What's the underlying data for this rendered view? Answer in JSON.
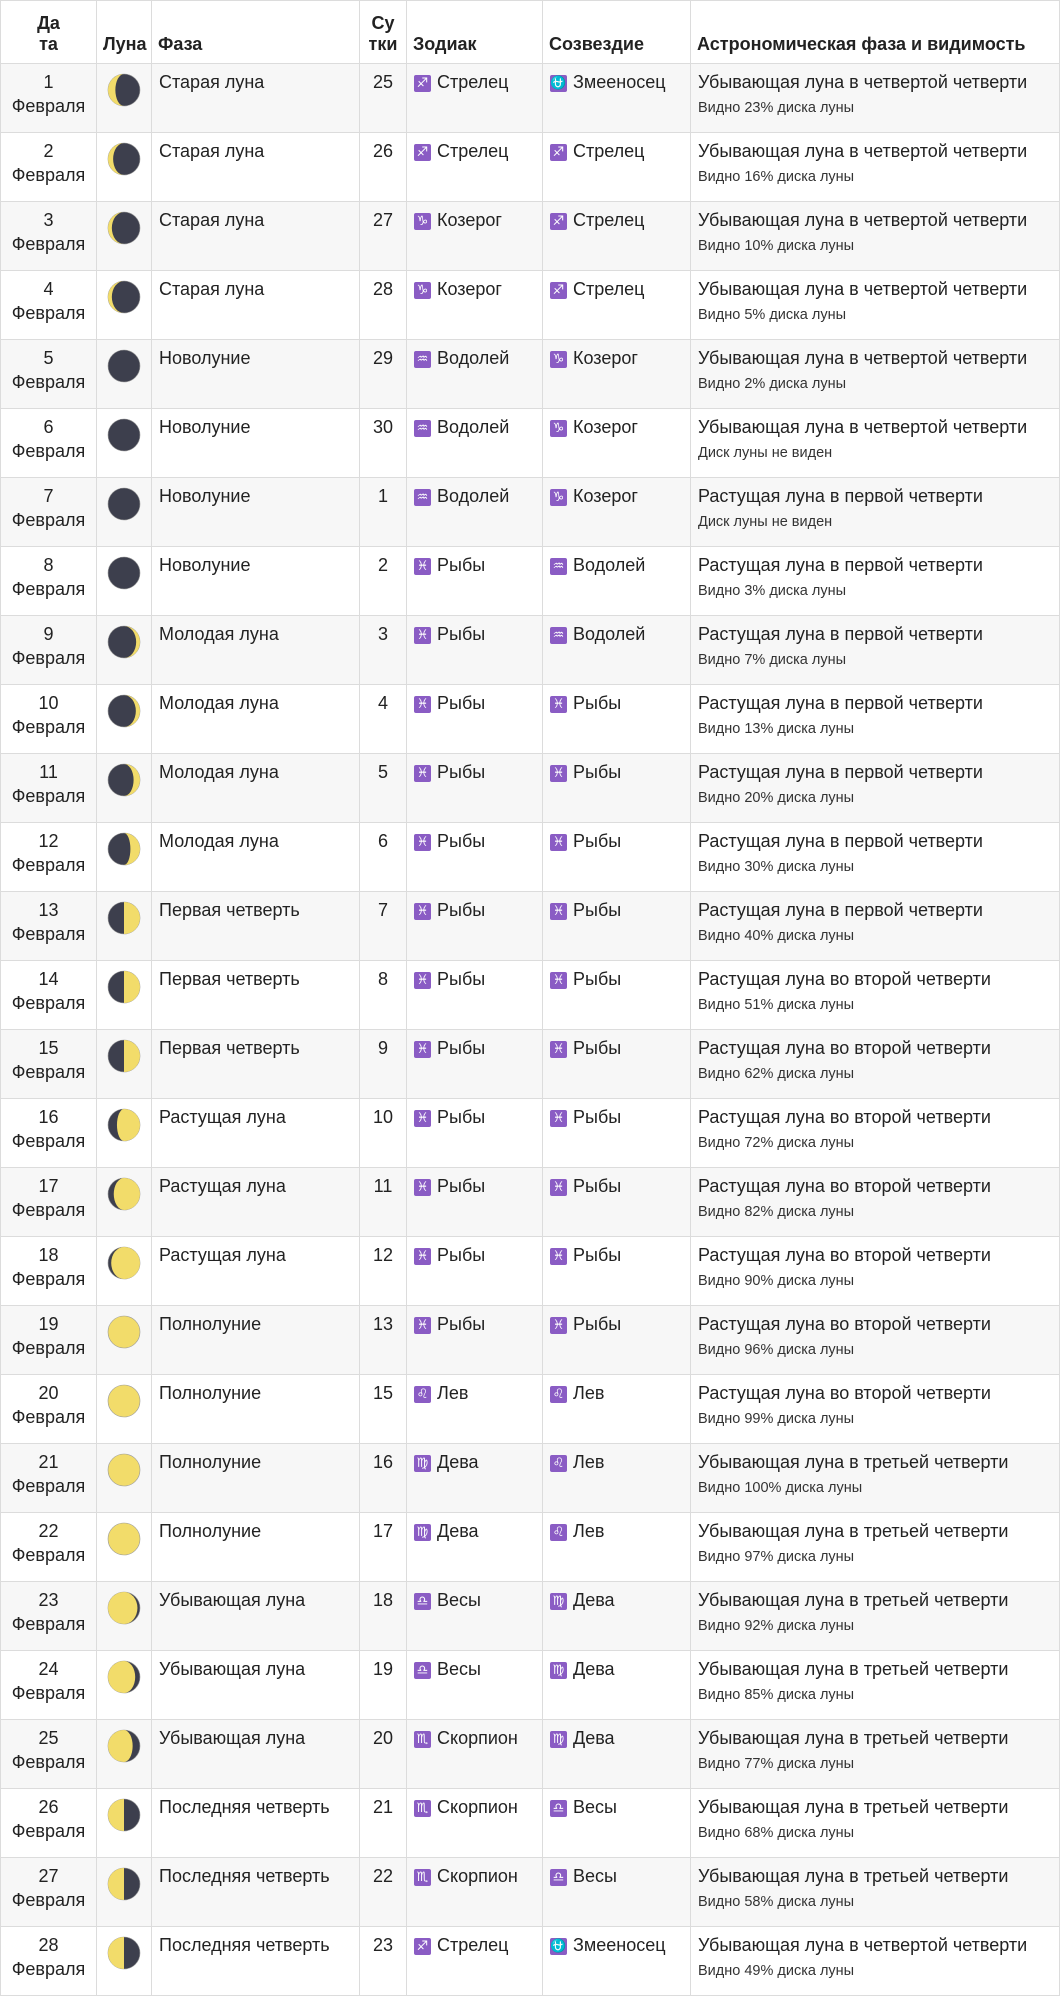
{
  "headers": {
    "date_line1": "Да",
    "date_line2": "та",
    "moon": "Луна",
    "phase": "Фаза",
    "day_line1": "Су",
    "day_line2": "тки",
    "zodiac": "Зодиак",
    "constellation": "Созвездие",
    "astro": "Астрономическая фаза и видимость"
  },
  "colors": {
    "sign_bg": "#8a5cc4",
    "moon_light": "#f2dc6a",
    "moon_dark": "#3d3f4d"
  },
  "rows": [
    {
      "day": "1",
      "month": "Февраля",
      "moon_icon": "waning-crescent",
      "moon_lit": 0.23,
      "phase": "Старая луна",
      "age": "25",
      "zodiac_glyph": "♐",
      "zodiac": "Стрелец",
      "const_glyph": "⛎",
      "constellation": "Змееносец",
      "astro": "Убывающая луна в четвертой четверти",
      "visibility": "Видно 23% диска луны"
    },
    {
      "day": "2",
      "month": "Февраля",
      "moon_icon": "waning-crescent",
      "moon_lit": 0.16,
      "phase": "Старая луна",
      "age": "26",
      "zodiac_glyph": "♐",
      "zodiac": "Стрелец",
      "const_glyph": "♐",
      "constellation": "Стрелец",
      "astro": "Убывающая луна в четвертой четверти",
      "visibility": "Видно 16% диска луны"
    },
    {
      "day": "3",
      "month": "Февраля",
      "moon_icon": "waning-crescent",
      "moon_lit": 0.1,
      "phase": "Старая луна",
      "age": "27",
      "zodiac_glyph": "♑",
      "zodiac": "Козерог",
      "const_glyph": "♐",
      "constellation": "Стрелец",
      "astro": "Убывающая луна в четвертой четверти",
      "visibility": "Видно 10% диска луны"
    },
    {
      "day": "4",
      "month": "Февраля",
      "moon_icon": "waning-crescent",
      "moon_lit": 0.05,
      "phase": "Старая луна",
      "age": "28",
      "zodiac_glyph": "♑",
      "zodiac": "Козерог",
      "const_glyph": "♐",
      "constellation": "Стрелец",
      "astro": "Убывающая луна в четвертой четверти",
      "visibility": "Видно 5% диска луны"
    },
    {
      "day": "5",
      "month": "Февраля",
      "moon_icon": "new-moon",
      "moon_lit": 0.02,
      "phase": "Новолуние",
      "age": "29",
      "zodiac_glyph": "♒",
      "zodiac": "Водолей",
      "const_glyph": "♑",
      "constellation": "Козерог",
      "astro": "Убывающая луна в четвертой четверти",
      "visibility": "Видно 2% диска луны"
    },
    {
      "day": "6",
      "month": "Февраля",
      "moon_icon": "new-moon",
      "moon_lit": 0,
      "phase": "Новолуние",
      "age": "30",
      "zodiac_glyph": "♒",
      "zodiac": "Водолей",
      "const_glyph": "♑",
      "constellation": "Козерог",
      "astro": "Убывающая луна в четвертой четверти",
      "visibility": "Диск луны не виден"
    },
    {
      "day": "7",
      "month": "Февраля",
      "moon_icon": "new-moon",
      "moon_lit": 0,
      "phase": "Новолуние",
      "age": "1",
      "zodiac_glyph": "♒",
      "zodiac": "Водолей",
      "const_glyph": "♑",
      "constellation": "Козерог",
      "astro": "Растущая луна в первой четверти",
      "visibility": "Диск луны не виден"
    },
    {
      "day": "8",
      "month": "Февраля",
      "moon_icon": "new-moon",
      "moon_lit": 0.03,
      "phase": "Новолуние",
      "age": "2",
      "zodiac_glyph": "♓",
      "zodiac": "Рыбы",
      "const_glyph": "♒",
      "constellation": "Водолей",
      "astro": "Растущая луна в первой четверти",
      "visibility": "Видно 3% диска луны"
    },
    {
      "day": "9",
      "month": "Февраля",
      "moon_icon": "waxing-crescent",
      "moon_lit": 0.07,
      "phase": "Молодая луна",
      "age": "3",
      "zodiac_glyph": "♓",
      "zodiac": "Рыбы",
      "const_glyph": "♒",
      "constellation": "Водолей",
      "astro": "Растущая луна в первой четверти",
      "visibility": "Видно 7% диска луны"
    },
    {
      "day": "10",
      "month": "Февраля",
      "moon_icon": "waxing-crescent",
      "moon_lit": 0.13,
      "phase": "Молодая луна",
      "age": "4",
      "zodiac_glyph": "♓",
      "zodiac": "Рыбы",
      "const_glyph": "♓",
      "constellation": "Рыбы",
      "astro": "Растущая луна в первой четверти",
      "visibility": "Видно 13% диска луны"
    },
    {
      "day": "11",
      "month": "Февраля",
      "moon_icon": "waxing-crescent",
      "moon_lit": 0.2,
      "phase": "Молодая луна",
      "age": "5",
      "zodiac_glyph": "♓",
      "zodiac": "Рыбы",
      "const_glyph": "♓",
      "constellation": "Рыбы",
      "astro": "Растущая луна в первой четверти",
      "visibility": "Видно 20% диска луны"
    },
    {
      "day": "12",
      "month": "Февраля",
      "moon_icon": "waxing-crescent",
      "moon_lit": 0.3,
      "phase": "Молодая луна",
      "age": "6",
      "zodiac_glyph": "♓",
      "zodiac": "Рыбы",
      "const_glyph": "♓",
      "constellation": "Рыбы",
      "astro": "Растущая луна в первой четверти",
      "visibility": "Видно 30% диска луны"
    },
    {
      "day": "13",
      "month": "Февраля",
      "moon_icon": "first-quarter",
      "moon_lit": 0.4,
      "phase": "Первая четверть",
      "age": "7",
      "zodiac_glyph": "♓",
      "zodiac": "Рыбы",
      "const_glyph": "♓",
      "constellation": "Рыбы",
      "astro": "Растущая луна в первой четверти",
      "visibility": "Видно 40% диска луны"
    },
    {
      "day": "14",
      "month": "Февраля",
      "moon_icon": "first-quarter",
      "moon_lit": 0.51,
      "phase": "Первая четверть",
      "age": "8",
      "zodiac_glyph": "♓",
      "zodiac": "Рыбы",
      "const_glyph": "♓",
      "constellation": "Рыбы",
      "astro": "Растущая луна во второй четверти",
      "visibility": "Видно 51% диска луны"
    },
    {
      "day": "15",
      "month": "Февраля",
      "moon_icon": "first-quarter",
      "moon_lit": 0.62,
      "phase": "Первая четверть",
      "age": "9",
      "zodiac_glyph": "♓",
      "zodiac": "Рыбы",
      "const_glyph": "♓",
      "constellation": "Рыбы",
      "astro": "Растущая луна во второй четверти",
      "visibility": "Видно 62% диска луны"
    },
    {
      "day": "16",
      "month": "Февраля",
      "moon_icon": "waxing-gibbous",
      "moon_lit": 0.72,
      "phase": "Растущая луна",
      "age": "10",
      "zodiac_glyph": "♓",
      "zodiac": "Рыбы",
      "const_glyph": "♓",
      "constellation": "Рыбы",
      "astro": "Растущая луна во второй четверти",
      "visibility": "Видно 72% диска луны"
    },
    {
      "day": "17",
      "month": "Февраля",
      "moon_icon": "waxing-gibbous",
      "moon_lit": 0.82,
      "phase": "Растущая луна",
      "age": "11",
      "zodiac_glyph": "♓",
      "zodiac": "Рыбы",
      "const_glyph": "♓",
      "constellation": "Рыбы",
      "astro": "Растущая луна во второй четверти",
      "visibility": "Видно 82% диска луны"
    },
    {
      "day": "18",
      "month": "Февраля",
      "moon_icon": "waxing-gibbous",
      "moon_lit": 0.9,
      "phase": "Растущая луна",
      "age": "12",
      "zodiac_glyph": "♓",
      "zodiac": "Рыбы",
      "const_glyph": "♓",
      "constellation": "Рыбы",
      "astro": "Растущая луна во второй четверти",
      "visibility": "Видно 90% диска луны"
    },
    {
      "day": "19",
      "month": "Февраля",
      "moon_icon": "full-moon",
      "moon_lit": 0.96,
      "phase": "Полнолуние",
      "age": "13",
      "zodiac_glyph": "♓",
      "zodiac": "Рыбы",
      "const_glyph": "♓",
      "constellation": "Рыбы",
      "astro": "Растущая луна во второй четверти",
      "visibility": "Видно 96% диска луны"
    },
    {
      "day": "20",
      "month": "Февраля",
      "moon_icon": "full-moon",
      "moon_lit": 0.99,
      "phase": "Полнолуние",
      "age": "15",
      "zodiac_glyph": "♌",
      "zodiac": "Лев",
      "const_glyph": "♌",
      "constellation": "Лев",
      "astro": "Растущая луна во второй четверти",
      "visibility": "Видно 99% диска луны"
    },
    {
      "day": "21",
      "month": "Февраля",
      "moon_icon": "full-moon",
      "moon_lit": 1.0,
      "phase": "Полнолуние",
      "age": "16",
      "zodiac_glyph": "♍",
      "zodiac": "Дева",
      "const_glyph": "♌",
      "constellation": "Лев",
      "astro": "Убывающая луна в третьей четверти",
      "visibility": "Видно 100% диска луны"
    },
    {
      "day": "22",
      "month": "Февраля",
      "moon_icon": "full-moon",
      "moon_lit": 0.97,
      "phase": "Полнолуние",
      "age": "17",
      "zodiac_glyph": "♍",
      "zodiac": "Дева",
      "const_glyph": "♌",
      "constellation": "Лев",
      "astro": "Убывающая луна в третьей четверти",
      "visibility": "Видно 97% диска луны"
    },
    {
      "day": "23",
      "month": "Февраля",
      "moon_icon": "waning-gibbous",
      "moon_lit": 0.92,
      "phase": "Убывающая луна",
      "age": "18",
      "zodiac_glyph": "♎",
      "zodiac": "Весы",
      "const_glyph": "♍",
      "constellation": "Дева",
      "astro": "Убывающая луна в третьей четверти",
      "visibility": "Видно 92% диска луны"
    },
    {
      "day": "24",
      "month": "Февраля",
      "moon_icon": "waning-gibbous",
      "moon_lit": 0.85,
      "phase": "Убывающая луна",
      "age": "19",
      "zodiac_glyph": "♎",
      "zodiac": "Весы",
      "const_glyph": "♍",
      "constellation": "Дева",
      "astro": "Убывающая луна в третьей четверти",
      "visibility": "Видно 85% диска луны"
    },
    {
      "day": "25",
      "month": "Февраля",
      "moon_icon": "waning-gibbous",
      "moon_lit": 0.77,
      "phase": "Убывающая луна",
      "age": "20",
      "zodiac_glyph": "♏",
      "zodiac": "Скорпион",
      "const_glyph": "♍",
      "constellation": "Дева",
      "astro": "Убывающая луна в третьей четверти",
      "visibility": "Видно 77% диска луны"
    },
    {
      "day": "26",
      "month": "Февраля",
      "moon_icon": "last-quarter",
      "moon_lit": 0.68,
      "phase": "Последняя четверть",
      "age": "21",
      "zodiac_glyph": "♏",
      "zodiac": "Скорпион",
      "const_glyph": "♎",
      "constellation": "Весы",
      "astro": "Убывающая луна в третьей четверти",
      "visibility": "Видно 68% диска луны"
    },
    {
      "day": "27",
      "month": "Февраля",
      "moon_icon": "last-quarter",
      "moon_lit": 0.58,
      "phase": "Последняя четверть",
      "age": "22",
      "zodiac_glyph": "♏",
      "zodiac": "Скорпион",
      "const_glyph": "♎",
      "constellation": "Весы",
      "astro": "Убывающая луна в третьей четверти",
      "visibility": "Видно 58% диска луны"
    },
    {
      "day": "28",
      "month": "Февраля",
      "moon_icon": "last-quarter",
      "moon_lit": 0.49,
      "phase": "Последняя четверть",
      "age": "23",
      "zodiac_glyph": "♐",
      "zodiac": "Стрелец",
      "const_glyph": "⛎",
      "constellation": "Змееносец",
      "astro": "Убывающая луна в четвертой четверти",
      "visibility": "Видно 49% диска луны"
    }
  ]
}
